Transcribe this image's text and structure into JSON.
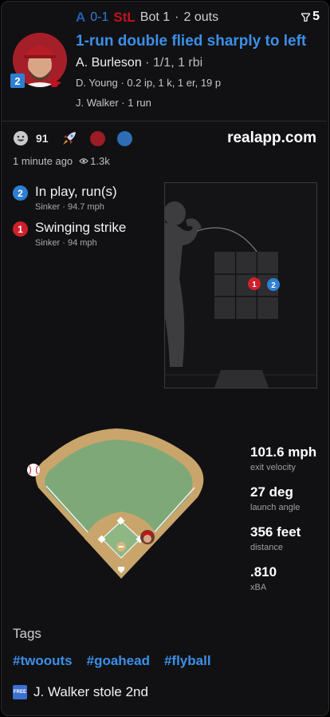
{
  "header": {
    "away_score": "0-1",
    "inning": "Bot 1",
    "outs": "2 outs",
    "count_value": "5",
    "headline": "1-run double flied sharply to left",
    "batter_name": "A. Burleson",
    "batter_line": "1/1, 1 rbi",
    "pitcher_line": "D. Young · 0.2 ip, 1 k, 1 er, 19 p",
    "runner_line": "J. Walker · 1 run",
    "batter_number": "2",
    "colors": {
      "away": "#1f5fb8",
      "home": "#c1121f",
      "accent": "#3b8fe8"
    }
  },
  "social": {
    "reaction_count": "91",
    "site": "realapp.com",
    "time_ago": "1 minute ago",
    "views": "1.3k",
    "reaction_dots": [
      "#9a1c24",
      "#2e6db4"
    ]
  },
  "pitches": [
    {
      "number": "2",
      "result": "In play, run(s)",
      "detail": "Sinker · 94.7 mph",
      "color": "#2d7fd4"
    },
    {
      "number": "1",
      "result": "Swinging strike",
      "detail": "Sinker · 94 mph",
      "color": "#d0202a"
    }
  ],
  "stats": [
    {
      "value": "101.6 mph",
      "label": "exit velocity"
    },
    {
      "value": "27 deg",
      "label": "launch angle"
    },
    {
      "value": "356 feet",
      "label": "distance"
    },
    {
      "value": ".810",
      "label": "xBA"
    }
  ],
  "tags": {
    "title": "Tags",
    "items": [
      "#twoouts",
      "#goahead",
      "#flyball"
    ]
  },
  "footer": {
    "icon_text": "FREE",
    "text": "J. Walker stole 2nd"
  }
}
